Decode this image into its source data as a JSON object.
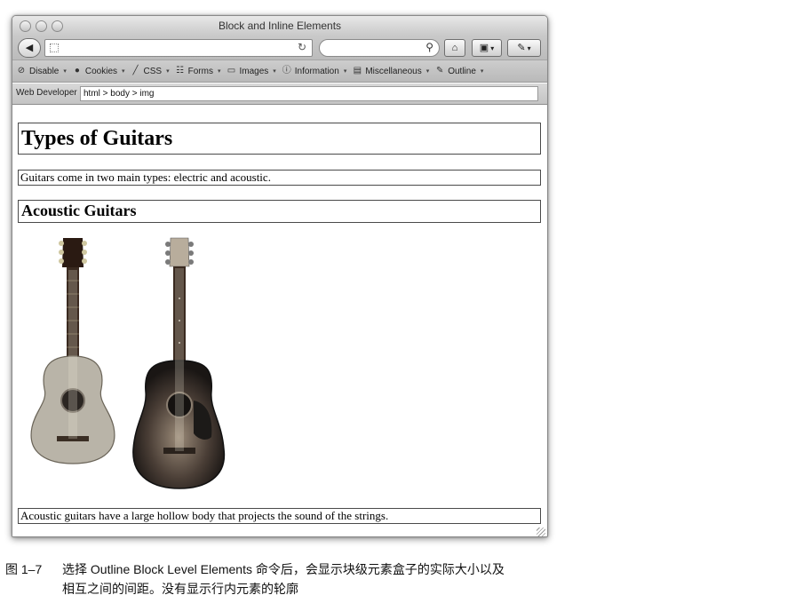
{
  "window": {
    "title": "Block and Inline Elements",
    "back_icon": "back-arrow-icon",
    "search_placeholder": "",
    "home_icon": "home-icon",
    "bookmarks_icon": "bookmarks-icon",
    "tools_icon": "wrench-icon"
  },
  "devbar": {
    "items": [
      {
        "label": "Disable",
        "icon": "disable-icon"
      },
      {
        "label": "Cookies",
        "icon": "cookies-icon"
      },
      {
        "label": "CSS",
        "icon": "css-icon"
      },
      {
        "label": "Forms",
        "icon": "forms-icon"
      },
      {
        "label": "Images",
        "icon": "images-icon"
      },
      {
        "label": "Information",
        "icon": "information-icon"
      },
      {
        "label": "Miscellaneous",
        "icon": "miscellaneous-icon"
      },
      {
        "label": "Outline",
        "icon": "outline-icon"
      }
    ]
  },
  "webdev": {
    "label": "Web Developer",
    "path": "html > body > img"
  },
  "page": {
    "h1": "Types of Guitars",
    "intro": "Guitars come in two main types: electric and acoustic.",
    "h2": "Acoustic Guitars",
    "body": "Acoustic guitars have a large hollow body that projects the sound of the strings."
  },
  "caption": {
    "figure": "图 1–7",
    "line1": "选择 Outline Block Level Elements 命令后，会显示块级元素盒子的实际大小以及",
    "line2": "相互之间的间距。没有显示行内元素的轮廓"
  },
  "colors": {
    "outline": "#4a4a4a",
    "chrome": "#c4c4c4"
  }
}
